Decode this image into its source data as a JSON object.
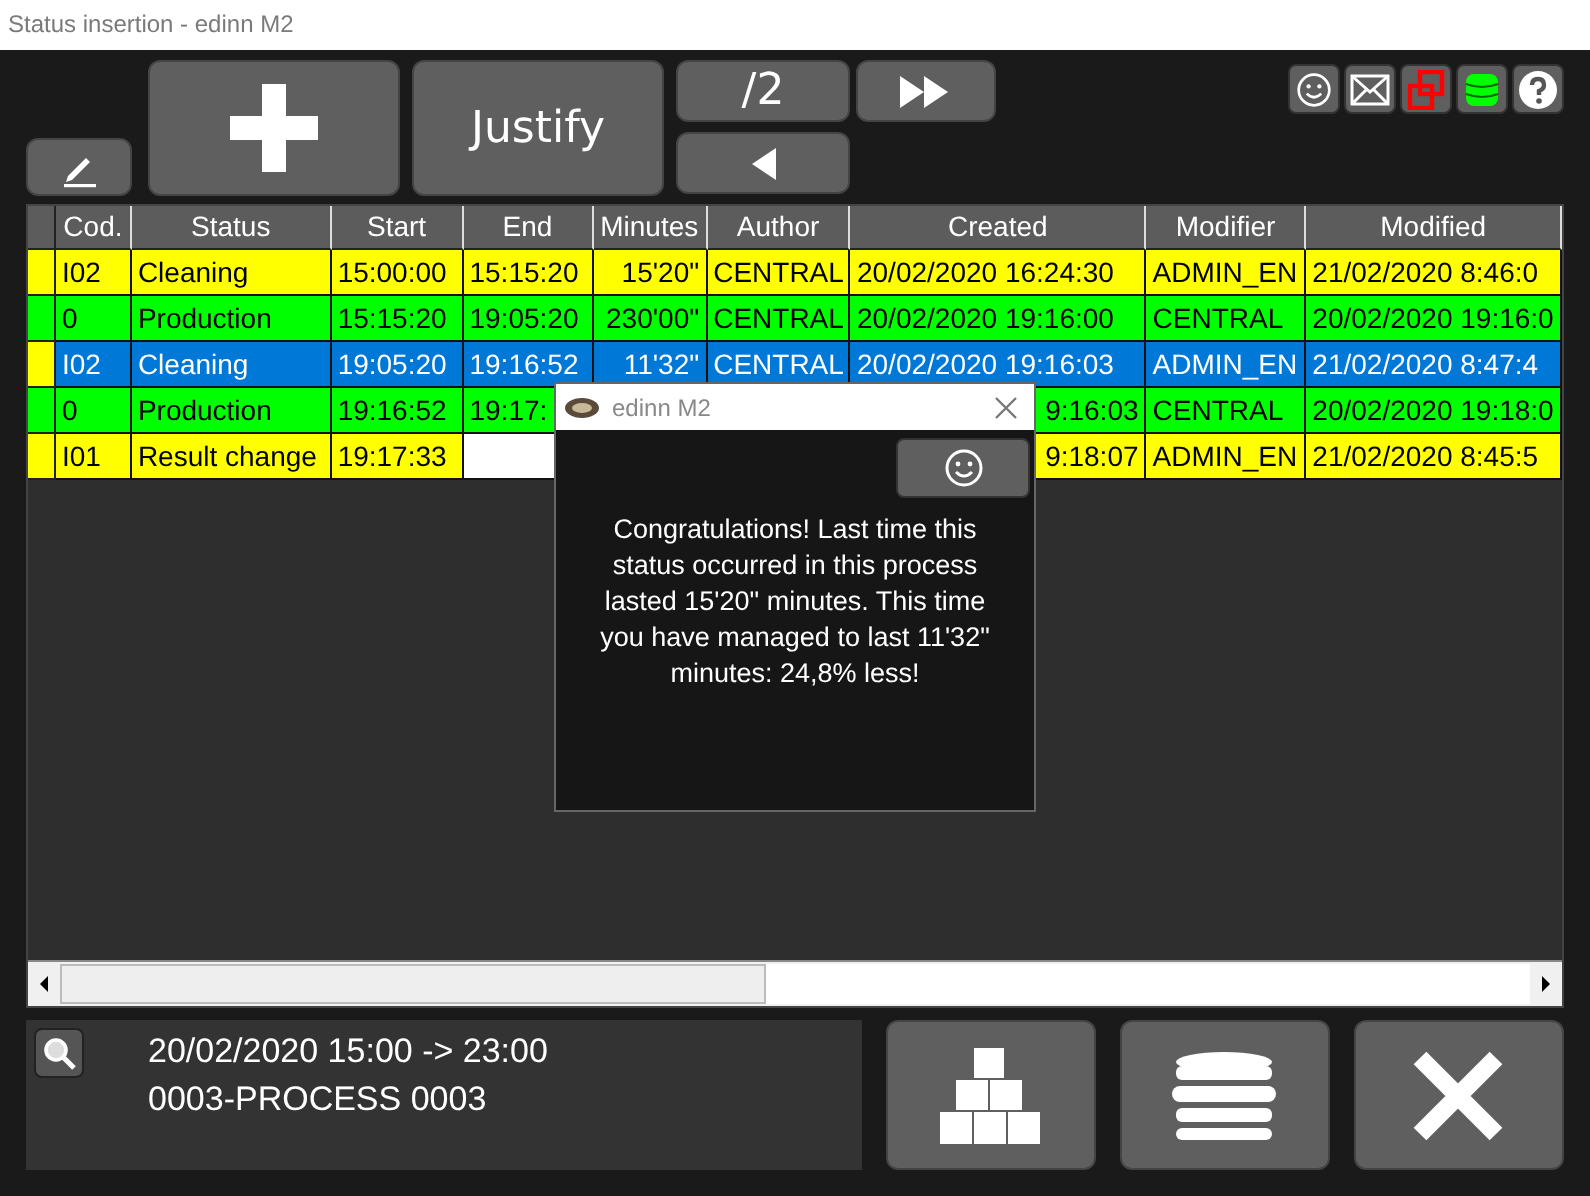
{
  "window": {
    "title": "Status insertion - edinn M2"
  },
  "toolbar": {
    "justify_label": "Justify",
    "page_label": "/2"
  },
  "table": {
    "columns": [
      "Cod.",
      "Status",
      "Start",
      "End",
      "Minutes",
      "Author",
      "Created",
      "Modifier",
      "Modified"
    ],
    "rows": [
      {
        "color": "#ffff00",
        "selected": false,
        "new_entry": false,
        "cod": "I02",
        "status": "Cleaning",
        "start": "15:00:00",
        "end": "15:15:20",
        "minutes": "15'20\"",
        "author": "CENTRAL",
        "created": "20/02/2020 16:24:30",
        "modifier": "ADMIN_EN",
        "modified": "21/02/2020 8:46:0"
      },
      {
        "color": "#00ff00",
        "selected": false,
        "new_entry": false,
        "cod": "0",
        "status": "Production",
        "start": "15:15:20",
        "end": "19:05:20",
        "minutes": "230'00\"",
        "author": "CENTRAL",
        "created": "20/02/2020 19:16:00",
        "modifier": "CENTRAL",
        "modified": "20/02/2020 19:16:0"
      },
      {
        "color": "#ffff00",
        "selected": true,
        "new_entry": false,
        "cod": "I02",
        "status": "Cleaning",
        "start": "19:05:20",
        "end": "19:16:52",
        "minutes": "11'32\"",
        "author": "CENTRAL",
        "created": "20/02/2020 19:16:03",
        "modifier": "ADMIN_EN",
        "modified": "21/02/2020 8:47:4"
      },
      {
        "color": "#00ff00",
        "selected": false,
        "new_entry": false,
        "cod": "0",
        "status": "Production",
        "start": "19:16:52",
        "end": "19:17:",
        "created": "9:16:03",
        "modifier": "CENTRAL",
        "modified": "20/02/2020 19:18:0"
      },
      {
        "color": "#ffff00",
        "selected": false,
        "new_entry": true,
        "cod": "I01",
        "status": "Result change",
        "start": "19:17:33",
        "created": "9:18:07",
        "modifier": "ADMIN_EN",
        "modified": "21/02/2020 8:45:5"
      }
    ]
  },
  "dialog": {
    "title": "edinn M2",
    "message": "Congratulations! Last time this status occurred in this process lasted 15'20\" minutes. This time you have managed to last 11'32\" minutes: 24,8% less!"
  },
  "info": {
    "period": "20/02/2020 15:00 -> 23:00",
    "process": "0003-PROCESS 0003"
  }
}
